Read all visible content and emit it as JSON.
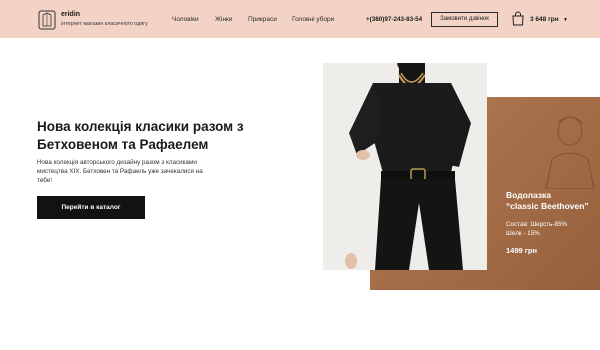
{
  "header": {
    "brand": "eridin",
    "tagline": "інтернет магазин класичного одягу",
    "nav": [
      {
        "label": "Чоловіки"
      },
      {
        "label": "Жінки"
      },
      {
        "label": "Прикраси"
      },
      {
        "label": "Головні убори"
      }
    ],
    "phone": "+(380)97-243-83-54",
    "callback_label": "Замовити дзвінок",
    "cart_total": "3 648 грн"
  },
  "hero": {
    "title": "Нова колекція класики разом з Бетховеном та Рафаелем",
    "description": "Нова колекція авторського дизайну разом з класиками мистецтва XIX. Бетховен та Рафаель уже зачекалися на тебе!",
    "cta_label": "Перейти в каталог"
  },
  "product": {
    "name_line1": "Водолазка",
    "name_line2": "“classic Beethoven”",
    "composition_line1": "Состав: Шерсть-85%",
    "composition_line2": "Шелк - 15%",
    "price": "1499 грн"
  },
  "colors": {
    "header_bg": "#f3d3c6",
    "cta_bg": "#121212",
    "card_bg": "#b47a52"
  }
}
